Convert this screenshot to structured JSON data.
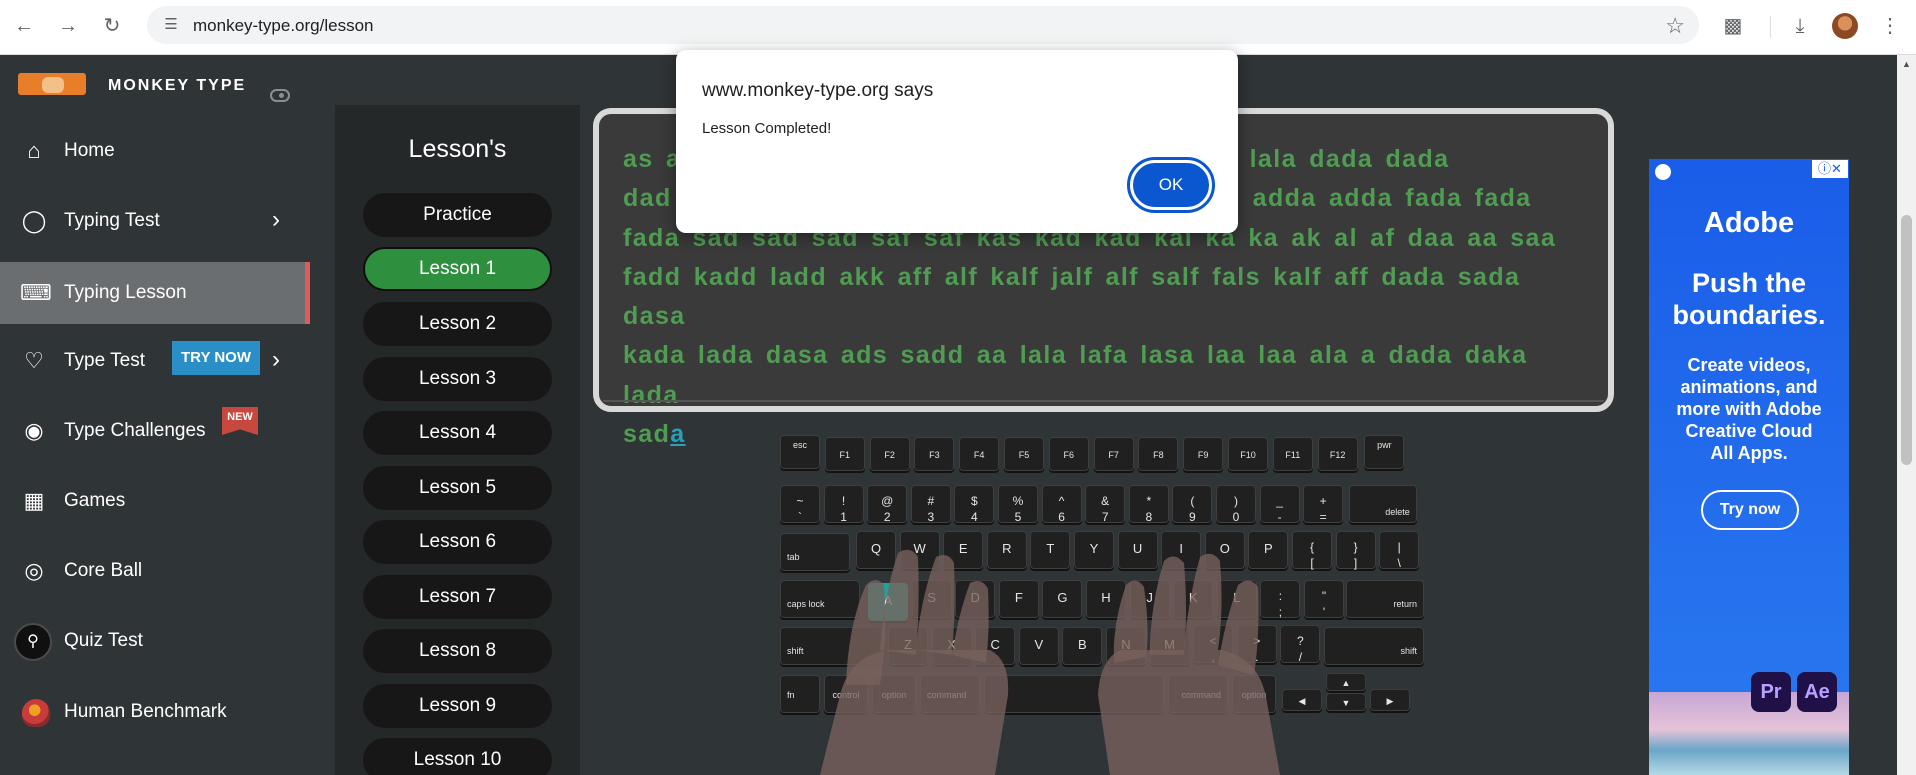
{
  "browser": {
    "url": "monkey-type.org/lesson"
  },
  "sidebar": {
    "brand": "MONKEY TYPE",
    "items": [
      {
        "label": "Home",
        "icon": "home-icon"
      },
      {
        "label": "Typing Test",
        "icon": "github-icon"
      },
      {
        "label": "Typing Lesson",
        "icon": "keyboard-icon",
        "active": true
      },
      {
        "label": "Type Test",
        "icon": "gitlab-icon",
        "badge": "TRY NOW"
      },
      {
        "label": "Type Challenges",
        "icon": "award-icon",
        "badge": "NEW"
      },
      {
        "label": "Games",
        "icon": "grid-icon"
      },
      {
        "label": "Core Ball",
        "icon": "target-icon"
      },
      {
        "label": "Quiz Test",
        "icon": "quiz-avatar-icon"
      },
      {
        "label": "Human Benchmark",
        "icon": "brain-icon"
      }
    ]
  },
  "lessons": {
    "title": "Lesson's",
    "items": [
      "Practice",
      "Lesson 1",
      "Lesson 2",
      "Lesson 3",
      "Lesson 4",
      "Lesson 5",
      "Lesson 6",
      "Lesson 7",
      "Lesson 8",
      "Lesson 9",
      "Lesson 10"
    ],
    "active_index": 1
  },
  "typing": {
    "line1": "as a",
    "line1_end": "d lala lala lala dada dada",
    "line2": "dad",
    "line2_end": "add adda adda fada fada",
    "line3": "fada",
    "line3_end": "sad sad sad saf saf kas kad kad kal ka ka ak al af daa aa saa",
    "line4": "fadd kadd ladd akk aff alf kalf jalf alf salf fals kalf aff dada sada dasa",
    "line5": "kada lada dasa ads sadd aa lala lafa lasa laa laa ala a dada daka lada",
    "line6": "sad",
    "cursor_char": "a"
  },
  "keyboard": {
    "row0": [
      "esc",
      "F1",
      "F2",
      "F3",
      "F4",
      "F5",
      "F6",
      "F7",
      "F8",
      "F9",
      "F10",
      "F11",
      "F12",
      "pwr"
    ],
    "row1": [
      [
        "~",
        "`"
      ],
      [
        "!",
        "1"
      ],
      [
        "@",
        "2"
      ],
      [
        "#",
        "3"
      ],
      [
        "$",
        "4"
      ],
      [
        "%",
        "5"
      ],
      [
        "^",
        "6"
      ],
      [
        "&",
        "7"
      ],
      [
        "*",
        "8"
      ],
      [
        "(",
        "9"
      ],
      [
        ")",
        "0"
      ],
      [
        "_",
        "-"
      ],
      [
        "+",
        "="
      ]
    ],
    "row1_end": "delete",
    "row2_start": "tab",
    "row2": [
      "Q",
      "W",
      "E",
      "R",
      "T",
      "Y",
      "U",
      "I",
      "O",
      "P"
    ],
    "row2_extra": [
      [
        "{",
        "["
      ],
      [
        "}",
        "]"
      ],
      [
        "|",
        "\\"
      ]
    ],
    "row3_start": "caps lock",
    "row3": [
      "A",
      "S",
      "D",
      "F",
      "G",
      "H",
      "J",
      "K",
      "L"
    ],
    "row3_extra": [
      [
        ":",
        ";"
      ],
      [
        "\"",
        "'"
      ]
    ],
    "row3_end": "return",
    "row4_start": "shift",
    "row4": [
      "Z",
      "X",
      "C",
      "V",
      "B",
      "N",
      "M"
    ],
    "row4_extra": [
      [
        "<",
        ","
      ],
      [
        ">",
        "."
      ],
      [
        "?",
        "/"
      ]
    ],
    "row4_end": "shift",
    "row5": [
      "fn",
      "control",
      "option",
      "command",
      "command",
      "option"
    ],
    "arrows": [
      "◀",
      "▲",
      "▼",
      "▶"
    ],
    "highlighted_key": "A"
  },
  "ad": {
    "brand": "Adobe",
    "headline": "Push the boundaries.",
    "body": "Create videos, animations, and more with Adobe Creative Cloud All Apps.",
    "cta": "Try now",
    "app1": "Pr",
    "app2": "Ae",
    "info": "ⓘ✕"
  },
  "alert": {
    "title": "www.monkey-type.org says",
    "message": "Lesson Completed!",
    "ok": "OK"
  },
  "colors": {
    "accent_green": "#2e8f3e",
    "text_green": "#4f9c52",
    "key_highlight": "#22a39a",
    "active_border": "#e05b5b",
    "dialog_button": "#0b57d0"
  }
}
